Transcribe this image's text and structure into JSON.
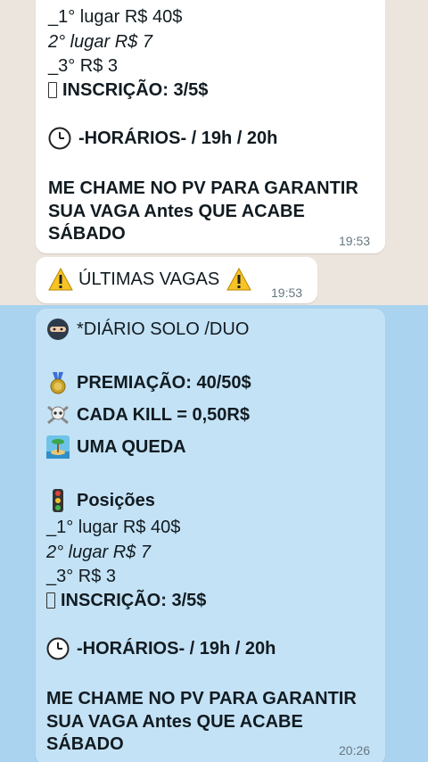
{
  "message1": {
    "line1": "_1° lugar R$ 40$",
    "line2": "2° lugar R$ 7",
    "line3": "_3° R$ 3",
    "line4": "INSCRIÇÃO: 3/5$",
    "line5": "-HORÁRIOS- / 19h / 20h",
    "line6": "ME CHAME NO PV PARA GARANTIR",
    "line7": "SUA VAGA Antes QUE ACABE",
    "line8": "SÁBADO",
    "time": "19:53"
  },
  "message2": {
    "text": "ÚLTIMAS VAGAS",
    "time": "19:53"
  },
  "message3": {
    "line1": "*DIÁRIO SOLO /DUO",
    "line2": "PREMIAÇÃO: 40/50$",
    "line3": "CADA KILL = 0,50R$",
    "line4": "UMA QUEDA",
    "line5": "Posições",
    "line6": "_1° lugar R$ 40$",
    "line7": "2° lugar R$ 7",
    "line8": "_3° R$ 3",
    "line9": "INSCRIÇÃO: 3/5$",
    "line10": "-HORÁRIOS- / 19h / 20h",
    "line11": "ME CHAME NO PV PARA GARANTIR",
    "line12": "SUA VAGA Antes QUE ACABE",
    "line13": "SÁBADO",
    "time": "20:26"
  },
  "colors": {
    "chat_bg": "#ece5dd",
    "selected_bg": "#a9d3ef",
    "bubble": "#ffffff",
    "bubble_selected": "#c4e2f5"
  }
}
